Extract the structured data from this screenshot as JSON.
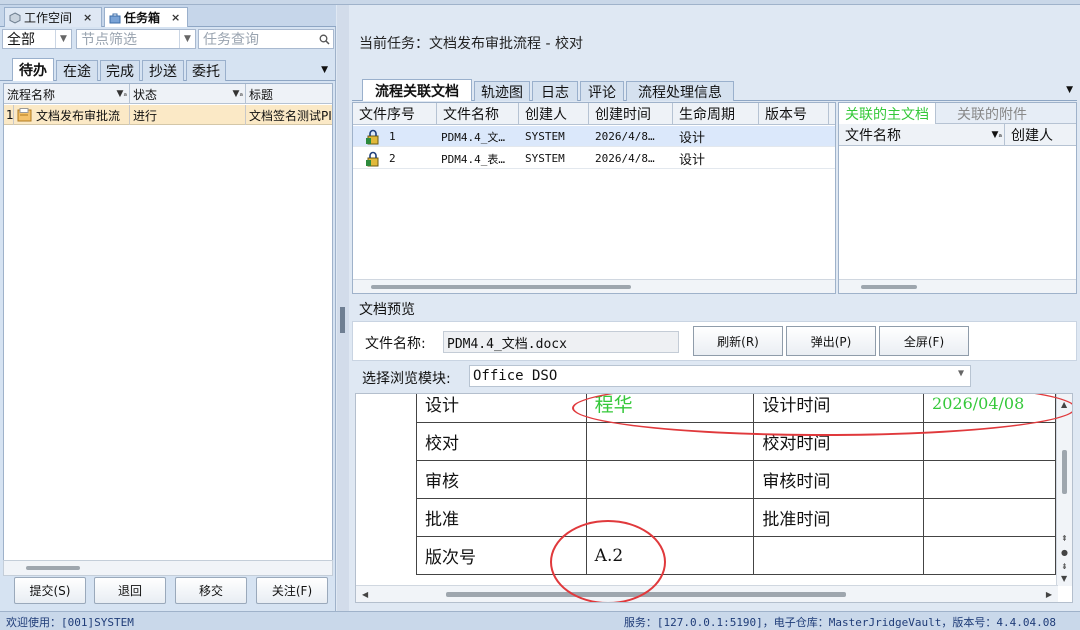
{
  "doc_tabs": [
    {
      "label": "工作空间",
      "close": "×"
    },
    {
      "label": "任务箱",
      "close": "×"
    }
  ],
  "filters": {
    "scope_value": "全部",
    "node_filter_placeholder": "节点筛选",
    "task_query_placeholder": "任务查询"
  },
  "status_tabs": [
    "待办",
    "在途",
    "完成",
    "抄送",
    "委托"
  ],
  "task_grid": {
    "columns": [
      "流程名称",
      "状态",
      "标题"
    ],
    "rows": [
      {
        "index": "1",
        "name": "文档发布审批流",
        "status": "进行",
        "title": "文档签名测试PI"
      }
    ]
  },
  "left_buttons": [
    "提交(S)",
    "退回",
    "移交",
    "关注(F)"
  ],
  "current_task": "当前任务：文档发布审批流程 - 校对",
  "right_tabs": [
    "流程关联文档",
    "轨迹图",
    "日志",
    "评论",
    "流程处理信息"
  ],
  "file_grid": {
    "columns": [
      "文件序号",
      "文件名称",
      "创建人",
      "创建时间",
      "生命周期",
      "版本号"
    ],
    "rows": [
      {
        "seq": "1",
        "name": "PDM4.4_文…",
        "creator": "SYSTEM",
        "time": "2026/4/8…",
        "lifecycle": "设计",
        "version": ""
      },
      {
        "seq": "2",
        "name": "PDM4.4_表…",
        "creator": "SYSTEM",
        "time": "2026/4/8…",
        "lifecycle": "设计",
        "version": ""
      }
    ]
  },
  "assoc_panel": {
    "tabs": [
      "关联的主文档",
      "关联的附件"
    ],
    "columns": [
      "文件名称",
      "创建人"
    ]
  },
  "preview": {
    "title": "文档预览",
    "file_label": "文件名称:",
    "file_value": "PDM4.4_文档.docx",
    "buttons": [
      "刷新(R)",
      "弹出(P)",
      "全屏(F)"
    ],
    "module_label": "选择浏览模块:",
    "module_value": "Office DSO"
  },
  "doc_table": [
    {
      "label": "设计",
      "value": "程华",
      "time_label": "设计时间",
      "time_value": "2026/04/08"
    },
    {
      "label": "校对",
      "value": "",
      "time_label": "校对时间",
      "time_value": ""
    },
    {
      "label": "审核",
      "value": "",
      "time_label": "审核时间",
      "time_value": ""
    },
    {
      "label": "批准",
      "value": "",
      "time_label": "批准时间",
      "time_value": ""
    },
    {
      "label": "版次号",
      "value": "A.2",
      "time_label": "",
      "time_value": ""
    }
  ],
  "colors": {
    "signature_green": "#35c83a",
    "annotation_red": "#e0393c",
    "selected_row": "#fbe9c6"
  },
  "status_bar": {
    "left": "欢迎使用：[001]SYSTEM",
    "right": "服务：[127.0.0.1:5190]，电子仓库：MasterJridgeVault，版本号：4.4.04.08"
  }
}
